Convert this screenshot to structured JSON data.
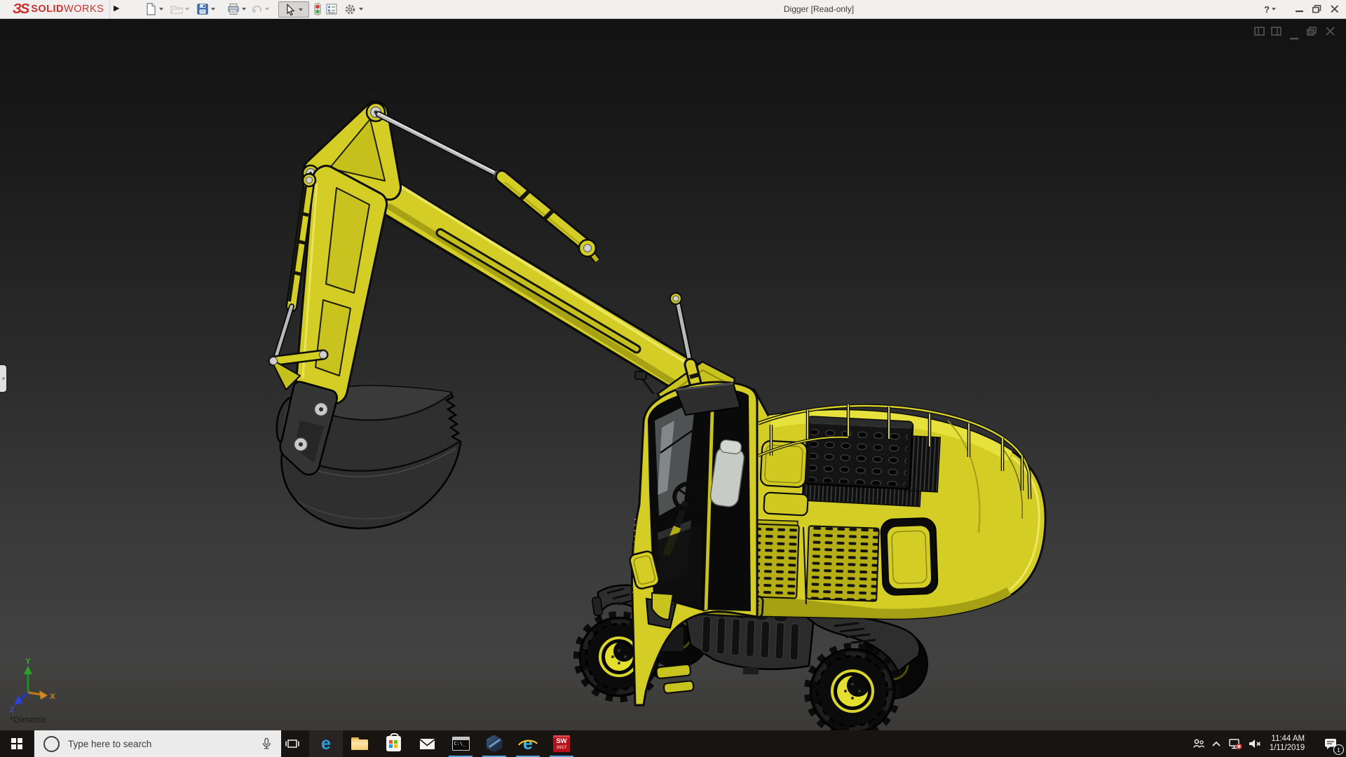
{
  "title_bar": {
    "logo": {
      "mark": "ЗS",
      "solid": "SOLID",
      "works": "WORKS"
    },
    "flyout_arrow": "▶",
    "document_title": "Digger [Read-only]",
    "help_label": "?",
    "toolbar_icons": [
      "new-document",
      "open",
      "save",
      "print",
      "undo",
      "select",
      "rebuild",
      "document-properties",
      "options"
    ],
    "toolbar_disabled": [
      "open",
      "undo"
    ],
    "toolbar_active": "select"
  },
  "viewport": {
    "view_orientation": "*Dimetric",
    "triad": {
      "x_label": "X",
      "y_label": "Y",
      "z_label": "Z"
    },
    "document_window_controls": [
      "tile-pane",
      "split-pane",
      "minimize",
      "restore",
      "close"
    ]
  },
  "taskbar": {
    "search_placeholder": "Type here to search",
    "edge_glyph": "e",
    "ie_glyph": "e",
    "command_prompt_text": "C:\\_",
    "solidworks_icon": {
      "line1": "SW",
      "line2": "2017"
    },
    "app_icons": [
      {
        "name": "task-view",
        "running": false
      },
      {
        "name": "microsoft-edge",
        "running": false
      },
      {
        "name": "file-explorer",
        "running": false
      },
      {
        "name": "microsoft-store",
        "running": false
      },
      {
        "name": "mail",
        "running": false
      },
      {
        "name": "command-prompt",
        "running": true
      },
      {
        "name": "edrawings",
        "running": true
      },
      {
        "name": "internet-explorer",
        "running": true
      },
      {
        "name": "solidworks-2017",
        "running": true
      }
    ],
    "tray": {
      "icons": [
        "people",
        "chevron-up",
        "network-disconnected",
        "volume-muted",
        "clock",
        "action-center"
      ],
      "time": "11:44 AM",
      "date": "1/11/2019",
      "notification_count": "1"
    }
  },
  "colors": {
    "machine_yellow": "#d3cd26",
    "solidworks_red": "#c8302b",
    "taskbar_underline": "#569fda",
    "viewport_top": "#121212",
    "viewport_bottom": "#424242"
  }
}
